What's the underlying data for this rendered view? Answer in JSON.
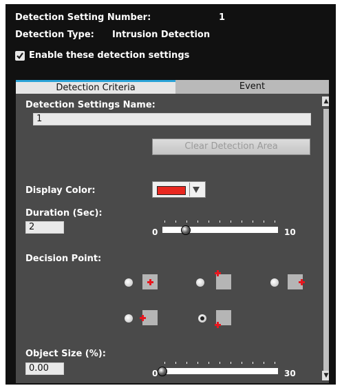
{
  "header": {
    "number_label": "Detection Setting Number:",
    "number_value": "1",
    "type_label": "Detection Type:",
    "type_value": "Intrusion Detection",
    "enable_label": "Enable these detection settings",
    "enable_checked": true
  },
  "tabs": [
    {
      "label": "Detection Criteria",
      "active": true
    },
    {
      "label": "Event",
      "active": false
    }
  ],
  "criteria": {
    "name_label": "Detection Settings Name:",
    "name_value": "1",
    "clear_button": "Clear Detection Area",
    "display_color_label": "Display Color:",
    "display_color": "#e8271f",
    "duration_label": "Duration (Sec):",
    "duration_value": "2",
    "duration_slider": {
      "min": "0",
      "max": "10",
      "value": 2
    },
    "decision_point_label": "Decision Point:",
    "decision_point_selected": 5,
    "object_size_label": "Object Size (%):",
    "object_size_value": "0.00",
    "object_size_slider": {
      "min": "0",
      "max": "30",
      "value": 0
    }
  },
  "colors": {
    "accent": "#2aa3d8",
    "panel": "#4a4a4a",
    "background": "#111111"
  }
}
